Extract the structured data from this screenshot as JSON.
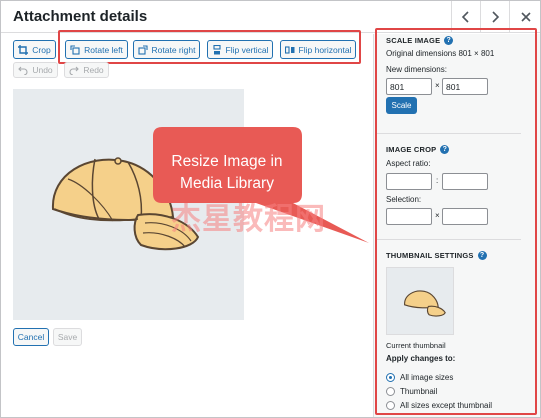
{
  "header": {
    "title": "Attachment details",
    "prev_icon": "chevron-left-icon",
    "next_icon": "chevron-right-icon",
    "close_icon": "close-icon"
  },
  "toolbar": {
    "crop": "Crop",
    "rotate_left": "Rotate left",
    "rotate_right": "Rotate right",
    "flip_vertical": "Flip vertical",
    "flip_horizontal": "Flip horizontal",
    "undo": "Undo",
    "redo": "Redo"
  },
  "callout": {
    "text_line1": "Resize Image in",
    "text_line2": "Media Library",
    "watermark": "杰星教程网"
  },
  "footer": {
    "cancel": "Cancel",
    "save": "Save"
  },
  "sidebar": {
    "scale": {
      "title": "SCALE IMAGE",
      "original": "Original dimensions 801 × 801",
      "new_dimensions": "New dimensions:",
      "width": "801",
      "height": "801",
      "separator": "×",
      "button": "Scale"
    },
    "crop": {
      "title": "IMAGE CROP",
      "aspect_ratio": "Aspect ratio:",
      "aspect_sep": ":",
      "selection": "Selection:",
      "selection_sep": "×"
    },
    "thumbnail": {
      "title": "THUMBNAIL SETTINGS",
      "current": "Current thumbnail",
      "apply": "Apply changes to:",
      "options": [
        "All image sizes",
        "Thumbnail",
        "All sizes except thumbnail"
      ],
      "selected": "All image sizes"
    }
  },
  "colors": {
    "accent": "#2271b1",
    "highlight": "#e04646",
    "callout": "#e85a55"
  }
}
